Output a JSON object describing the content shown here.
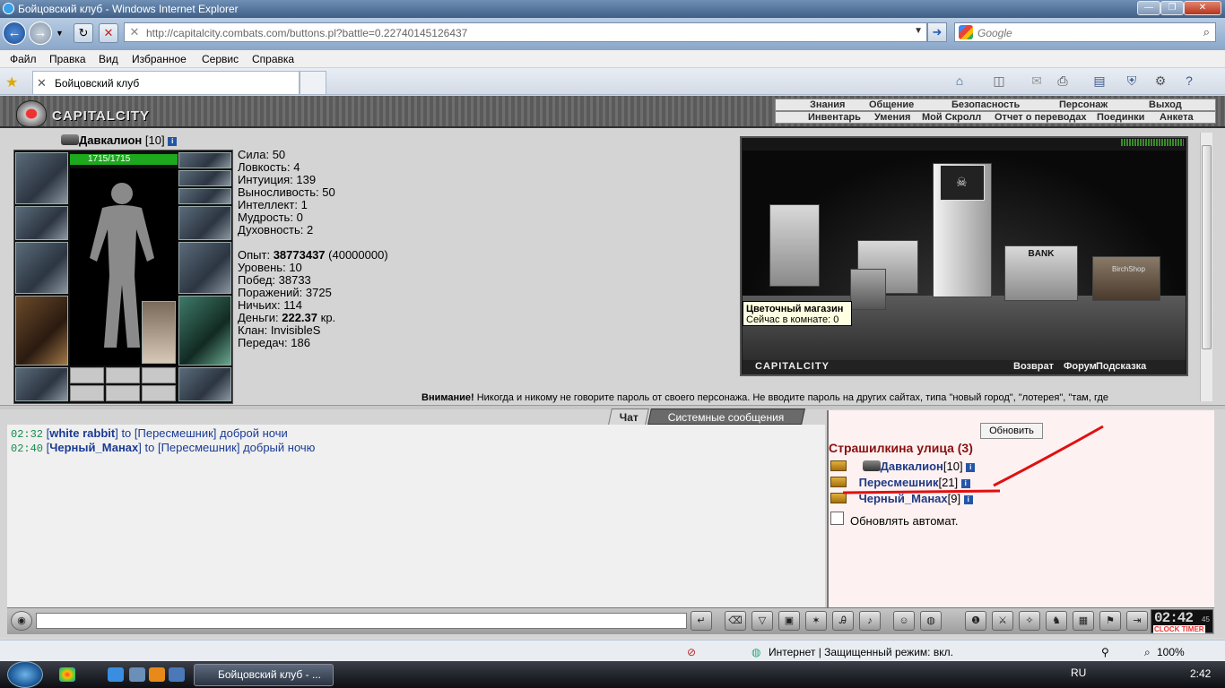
{
  "window": {
    "title": "Бойцовский клуб - Windows Internet Explorer"
  },
  "browser": {
    "url": "http://capitalcity.combats.com/buttons.pl?battle=0.22740145126437",
    "search_placeholder": "Google",
    "menu": [
      "Файл",
      "Правка",
      "Вид",
      "Избранное",
      "Сервис",
      "Справка"
    ],
    "tab_title": "Бойцовский клуб",
    "status_zone": "Интернет | Защищенный режим: вкл.",
    "zoom": "100%"
  },
  "game": {
    "logo": "CAPITALCITY",
    "nav_row1": [
      "Знания",
      "Общение",
      "Безопасность",
      "Персонаж",
      "Выход"
    ],
    "nav_row2": [
      "Инвентарь",
      "Умения",
      "Мой Скролл",
      "Отчет о переводах",
      "Поединки",
      "Анкета"
    ],
    "character": {
      "name": "Давкалион",
      "level": "[10]",
      "hp": "1715/1715",
      "stats": [
        {
          "label": "Сила:",
          "value": "50"
        },
        {
          "label": "Ловкость:",
          "value": "4"
        },
        {
          "label": "Интуиция:",
          "value": "139"
        },
        {
          "label": "Выносливость:",
          "value": "50"
        },
        {
          "label": "Интеллект:",
          "value": "1"
        },
        {
          "label": "Мудрость:",
          "value": "0"
        },
        {
          "label": "Духовность:",
          "value": "2"
        }
      ],
      "exp_label": "Опыт:",
      "exp": "38773437",
      "exp_next": "(40000000)",
      "level_label": "Уровень:",
      "level_value": "10",
      "wins_label": "Побед:",
      "wins": "38733",
      "losses_label": "Поражений:",
      "losses": "3725",
      "draws_label": "Ничьих:",
      "draws": "114",
      "money_label": "Деньги:",
      "money": "222.37",
      "money_unit": "кр.",
      "clan_label": "Клан:",
      "clan": "InvisibleS",
      "transfers_label": "Передач:",
      "transfers": "186"
    },
    "map": {
      "bank_label": "BANK",
      "shop_label": "BirchShop",
      "tooltip_title": "Цветочный магазин",
      "tooltip_sub": "Сейчас в комнате: 0",
      "footer_logo": "CAPITALCITY",
      "footer_links": [
        "Возврат",
        "Форум",
        "Подсказка"
      ]
    },
    "warning_bold": "Внимание!",
    "warning_text": " Никогда и никому не говорите пароль от своего персонажа. Не вводите пароль на других сайтах, типа \"новый город\", \"лотерея\", \"там, где",
    "chat_tabs": [
      "Чат",
      "Системные сообщения"
    ],
    "chat": [
      {
        "time": "02:32",
        "from": "white rabbit",
        "to": "to [Пересмешник]",
        "text": "доброй ночи"
      },
      {
        "time": "02:40",
        "from": "Черный_Манах",
        "to": "to [Пересмешник]",
        "text": "добрый ночю"
      }
    ],
    "online": {
      "refresh": "Обновить",
      "room": "Страшилкина улица (3)",
      "players": [
        {
          "name": "Давкалион",
          "level": "[10]"
        },
        {
          "name": "Пересмешник",
          "level": "[21]"
        },
        {
          "name": "Черный_Манах",
          "level": "[9]"
        }
      ],
      "auto_refresh": "Обновлять автомат."
    },
    "clock": {
      "time": "02:42",
      "sec": "45",
      "label": "CLOCK TIMER"
    }
  },
  "taskbar": {
    "item": "Бойцовский клуб - ...",
    "lang": "RU",
    "time": "2:42"
  }
}
